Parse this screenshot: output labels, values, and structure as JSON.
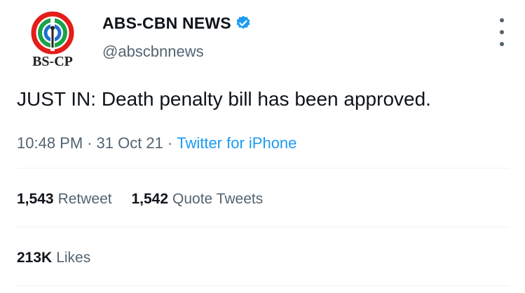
{
  "account": {
    "display_name": "ABS-CBN NEWS",
    "handle": "@abscbnnews",
    "avatar_text": "BS-CP",
    "verified_color": "#1d9bf0"
  },
  "tweet": {
    "text": "JUST IN: Death penalty bill has been approved.",
    "time": "10:48 PM",
    "separator": "·",
    "date": "31 Oct 21",
    "source": "Twitter for iPhone"
  },
  "stats": {
    "retweets_count": "1,543",
    "retweets_label": "Retweet",
    "quotes_count": "1,542",
    "quotes_label": "Quote Tweets",
    "likes_count": "213K",
    "likes_label": "Likes"
  },
  "colors": {
    "text": "#0f1419",
    "secondary": "#536471",
    "link": "#1d9bf0",
    "divider": "#eff3f4"
  }
}
